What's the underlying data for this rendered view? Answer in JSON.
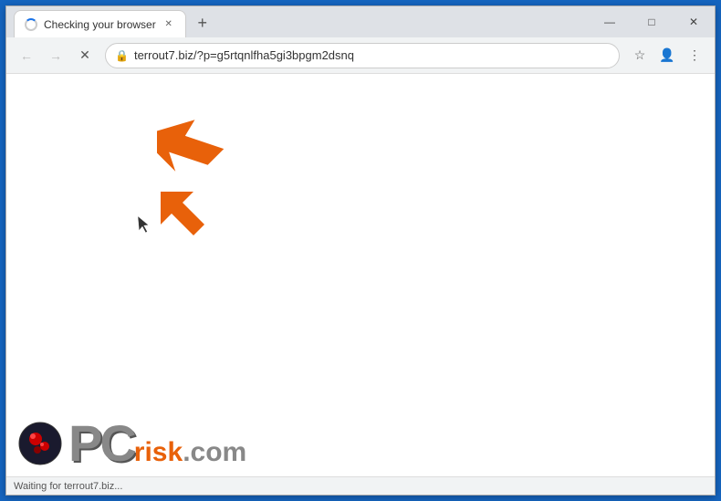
{
  "window": {
    "title": "Checking your browser",
    "tab_title": "Checking your browser",
    "url": "terrout7.biz/?p=g5rtqnlfha5gi3bpgm2dsnq",
    "status_text": "Waiting for terrout7.biz..."
  },
  "toolbar": {
    "back_label": "←",
    "forward_label": "→",
    "reload_label": "✕",
    "new_tab_label": "+",
    "bookmark_label": "☆",
    "account_label": "👤",
    "menu_label": "⋮"
  },
  "controls": {
    "minimize": "—",
    "maximize": "□",
    "close": "✕"
  },
  "watermark": {
    "pc_text": "PC",
    "risk_text": "risk",
    "dotcom_text": ".com"
  }
}
